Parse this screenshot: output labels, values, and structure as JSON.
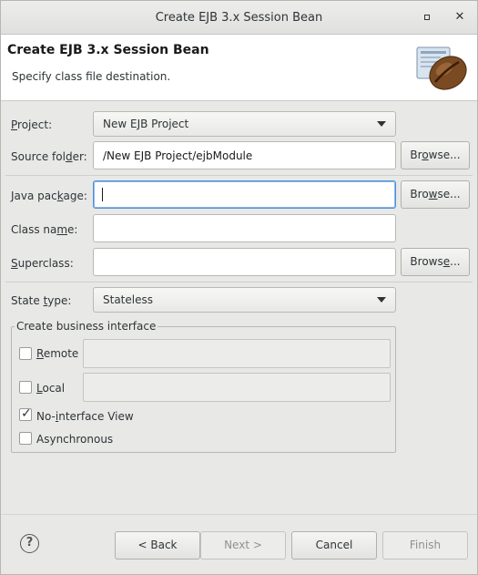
{
  "window": {
    "title": "Create EJB 3.x Session Bean"
  },
  "header": {
    "title": "Create EJB 3.x Session Bean",
    "description": "Specify class file destination.",
    "icon": "coffee-bean-icon"
  },
  "form": {
    "project": {
      "label_pre": "",
      "label_u": "P",
      "label_post": "roject:",
      "value": "New EJB Project"
    },
    "source_folder": {
      "label_pre": "Source fol",
      "label_u": "d",
      "label_post": "er:",
      "value": "/New EJB Project/ejbModule",
      "browse_pre": "Br",
      "browse_u": "o",
      "browse_post": "wse..."
    },
    "java_package": {
      "label_pre": "Java pac",
      "label_u": "k",
      "label_post": "age:",
      "value": "",
      "browse_pre": "Bro",
      "browse_u": "w",
      "browse_post": "se..."
    },
    "class_name": {
      "label_pre": "Class na",
      "label_u": "m",
      "label_post": "e:",
      "value": ""
    },
    "superclass": {
      "label_pre": "",
      "label_u": "S",
      "label_post": "uperclass:",
      "value": "",
      "browse_pre": "Brows",
      "browse_u": "e",
      "browse_post": "..."
    },
    "state_type": {
      "label_pre": "State ",
      "label_u": "t",
      "label_post": "ype:",
      "value": "Stateless"
    }
  },
  "business_interface": {
    "title": "Create business interface",
    "remote": {
      "label_pre": "",
      "label_u": "R",
      "label_post": "emote",
      "checked": false,
      "value": ""
    },
    "local": {
      "label_pre": "",
      "label_u": "L",
      "label_post": "ocal",
      "checked": false,
      "value": ""
    },
    "no_interface": {
      "label_pre": "No-",
      "label_u": "i",
      "label_post": "nterface View",
      "checked": true
    },
    "asynchronous": {
      "label": "Asynchronous",
      "checked": false
    }
  },
  "footer": {
    "help": "?",
    "back": "< Back",
    "next": "Next >",
    "cancel": "Cancel",
    "finish": "Finish"
  },
  "colors": {
    "focus_border": "#4a90d9",
    "window_bg": "#e8e8e7",
    "header_bg": "#ffffff"
  }
}
